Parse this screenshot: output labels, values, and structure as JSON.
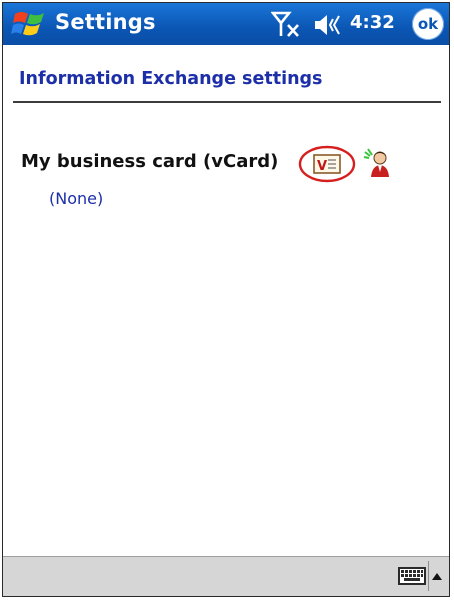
{
  "titlebar": {
    "title": "Settings",
    "time": "4:32",
    "ok_label": "ok",
    "start_icon": "windows-flag-icon",
    "signal_icon": "no-signal-antenna-icon",
    "speaker_icon": "speaker-icon"
  },
  "page": {
    "title": "Information Exchange settings"
  },
  "business_card": {
    "label": "My business card (vCard)",
    "value": "(None)",
    "vcard_icon": "vcard-icon",
    "beam_icon": "beam-contact-icon"
  },
  "bottom_bar": {
    "keyboard_icon": "keyboard-icon",
    "arrow_icon": "up-arrow-icon"
  },
  "colors": {
    "titlebar": "#0b56b4",
    "link": "#1c2fa8",
    "highlight_circle": "#d61f1f",
    "bottom_bar": "#d6d6d6"
  }
}
